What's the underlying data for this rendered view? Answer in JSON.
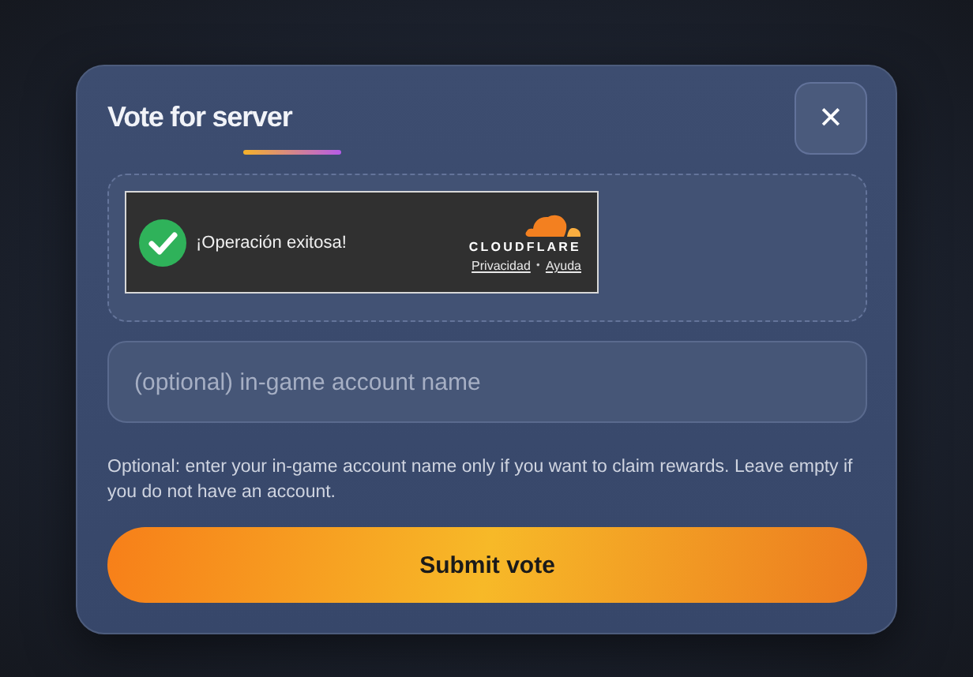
{
  "dialog": {
    "title": "Vote for server",
    "close": "✕"
  },
  "captcha": {
    "message": "¡Operación exitosa!",
    "brand": "CLOUDFLARE",
    "links": [
      {
        "label": "Privacidad"
      },
      {
        "label": "Ayuda"
      }
    ],
    "separator": "•"
  },
  "account_field": {
    "placeholder": "(optional) in-game account name"
  },
  "hint": "Optional: enter your in-game account name only if you want to claim rewards. Leave empty if you do not have an account.",
  "submit": {
    "label": "Submit vote"
  }
}
